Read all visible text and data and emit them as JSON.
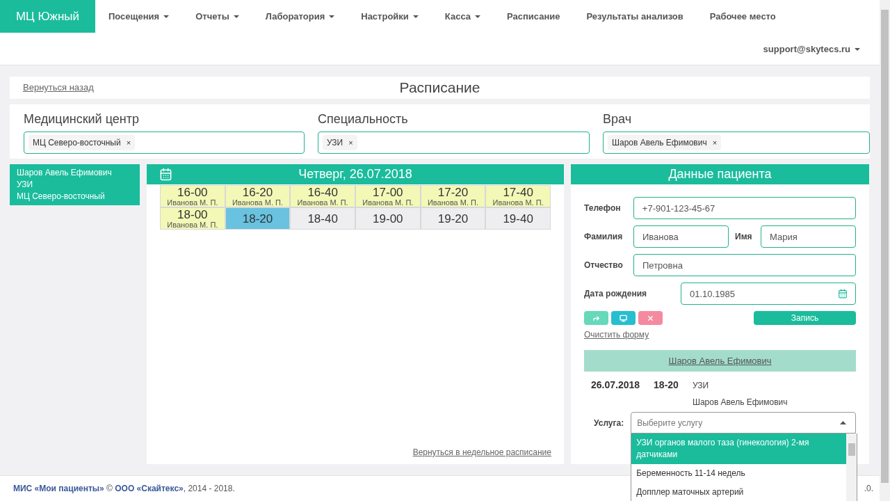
{
  "brand": "МЦ Южный",
  "nav": [
    {
      "label": "Посещения",
      "dropdown": true
    },
    {
      "label": "Отчеты",
      "dropdown": true
    },
    {
      "label": "Лаборатория",
      "dropdown": true
    },
    {
      "label": "Настройки",
      "dropdown": true
    },
    {
      "label": "Касса",
      "dropdown": true
    },
    {
      "label": "Расписание",
      "dropdown": false
    },
    {
      "label": "Результаты анализов",
      "dropdown": false
    },
    {
      "label": "Рабочее место",
      "dropdown": false
    }
  ],
  "user": "support@skytecs.ru",
  "back_link": "Вернуться назад",
  "page_title": "Расписание",
  "filters": [
    {
      "label": "Медицинский центр",
      "chips": [
        {
          "text": "МЦ Северо-восточный",
          "remove": "×"
        }
      ]
    },
    {
      "label": "Специальность",
      "chips": [
        {
          "text": "УЗИ",
          "remove": "×"
        }
      ]
    },
    {
      "label": "Врач",
      "chips": [
        {
          "text": "Шаров Авель Ефимович",
          "remove": "×"
        }
      ]
    }
  ],
  "doctor_card": [
    "Шаров Авель Ефимович",
    "УЗИ",
    "МЦ Северо-восточный"
  ],
  "schedule": {
    "day": "Четверг, 26.07.2018",
    "rows": [
      [
        {
          "time": "16-00",
          "patient": "Иванова М. П.",
          "kind": "booked",
          "selected": false
        },
        {
          "time": "16-20",
          "patient": "Иванова М. П.",
          "kind": "booked",
          "selected": false
        },
        {
          "time": "16-40",
          "patient": "Иванова М. П.",
          "kind": "booked",
          "selected": false
        },
        {
          "time": "17-00",
          "patient": "Иванова М. П.",
          "kind": "booked",
          "selected": false
        },
        {
          "time": "17-20",
          "patient": "Иванова М. П.",
          "kind": "booked",
          "selected": false
        },
        {
          "time": "17-40",
          "patient": "Иванова М. П.",
          "kind": "booked",
          "selected": false
        }
      ],
      [
        {
          "time": "18-00",
          "patient": "Иванова М. П.",
          "kind": "booked",
          "selected": false
        },
        {
          "time": "18-20",
          "kind": "free",
          "selected": true
        },
        {
          "time": "18-40",
          "kind": "free",
          "selected": false
        },
        {
          "time": "19-00",
          "kind": "free",
          "selected": false
        },
        {
          "time": "19-20",
          "kind": "free",
          "selected": false
        },
        {
          "time": "19-40",
          "kind": "free",
          "selected": false
        }
      ]
    ],
    "weekly_link": "Вернуться в недельное расписание"
  },
  "patient": {
    "title": "Данные пациента",
    "phone": {
      "label": "Телефон",
      "value": "+7-901-123-45-67"
    },
    "last_name": {
      "label": "Фамилия",
      "value": "Иванова"
    },
    "first_name": {
      "label": "Имя",
      "value": "Мария"
    },
    "middle_name": {
      "label": "Отчество",
      "value": "Петровна"
    },
    "birth_date": {
      "label": "Дата рождения",
      "value": "01.10.1985"
    },
    "actions": [
      {
        "kind": "forward"
      },
      {
        "kind": "comment"
      },
      {
        "kind": "cancel"
      }
    ],
    "submit": "Запись",
    "clear_link": "Очистить форму",
    "doctor_link": "Шаров Авель Ефимович",
    "visit": {
      "date": "26.07.2018",
      "time": "18-20",
      "specialty": "УЗИ",
      "doctor": "Шаров Авель Ефимович"
    },
    "service": {
      "label": "Услуга:",
      "placeholder": "Выберите услугу",
      "expanded": true,
      "options": [
        {
          "text": "УЗИ органов малого таза (гинекология) 2-мя датчиками",
          "selected": true
        },
        {
          "text": "Беременность 11-14 недель",
          "selected": false
        },
        {
          "text": "Допплер маточных артерий",
          "selected": false
        }
      ]
    }
  },
  "footer": {
    "text": "**МИС «Мои пациенты»** © **ООО «Скайтекс»**, 2014 - 2018.",
    "version": ".0."
  }
}
